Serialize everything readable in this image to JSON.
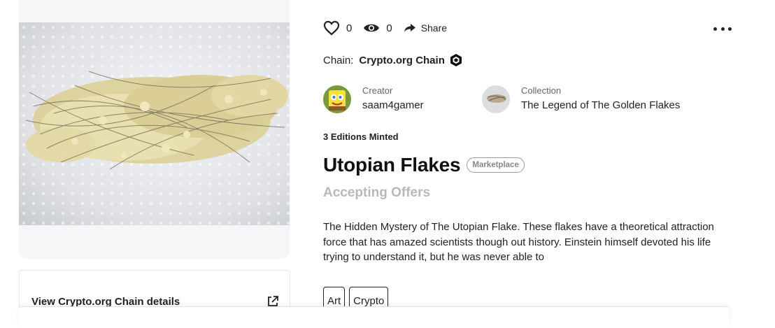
{
  "media": {
    "icon": "nft-artwork-image"
  },
  "chain_details": {
    "link_label": "View Crypto.org Chain details",
    "icon": "external-link-icon"
  },
  "actions": {
    "likes": "0",
    "views": "0",
    "share_label": "Share",
    "like_icon": "heart-icon",
    "view_icon": "eye-icon",
    "share_icon": "share-arrow-icon",
    "more_icon": "more-options-icon"
  },
  "chain": {
    "label": "Chain:",
    "value": "Crypto.org Chain",
    "icon": "cronos-hexagon-icon"
  },
  "creator": {
    "role": "Creator",
    "name": "saam4gamer"
  },
  "collection": {
    "role": "Collection",
    "name": "The Legend of The Golden Flakes"
  },
  "editions": "3 Editions Minted",
  "title": "Utopian Flakes",
  "badge": "Marketplace",
  "status": "Accepting Offers",
  "description": "The Hidden Mystery of The Utopian Flake. These flakes have a theoretical attraction force that has amazed scientists though out history. Einstein himself devoted his life trying to understand it, but he was never able to",
  "tags": [
    "Art",
    "Crypto"
  ],
  "colors": {
    "text": "#222222",
    "muted": "#b9b9bd",
    "card_bg": "#f5f6f8",
    "border": "#e6e7ea"
  }
}
